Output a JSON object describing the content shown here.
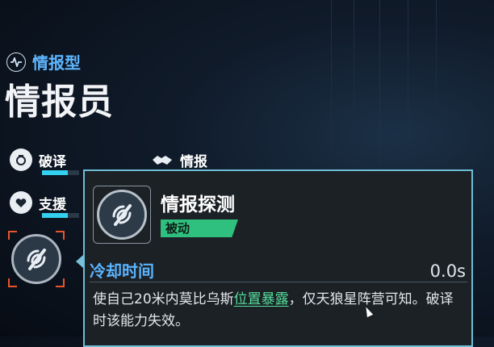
{
  "role": {
    "type_label": "情报型",
    "type_icon": "pulse-icon",
    "name": "情报员"
  },
  "stats": [
    {
      "label": "破译",
      "icon": "decode-icon",
      "level": 0.7
    },
    {
      "label": "情报",
      "icon": "handshake-icon",
      "level": 0.0
    },
    {
      "label": "支援",
      "icon": "heart-icon",
      "level": 0.7
    }
  ],
  "skill_slot": {
    "icon": "intel-probe-icon",
    "selected": true
  },
  "tooltip": {
    "title": "情报探测",
    "tag": "被动",
    "cooldown_label": "冷却时间",
    "cooldown_value": "0.0s",
    "desc_before": "使自己20米内莫比乌斯",
    "desc_highlight": "位置暴露",
    "desc_after": "，仅天狼星阵营可知。破译时该能力失效。"
  },
  "colors": {
    "accent_blue": "#5eb6ff",
    "bar_cyan": "#33d0f0",
    "tag_green": "#2fbf7f",
    "highlight_green": "#55e09c",
    "selection_orange": "#e8542b"
  }
}
